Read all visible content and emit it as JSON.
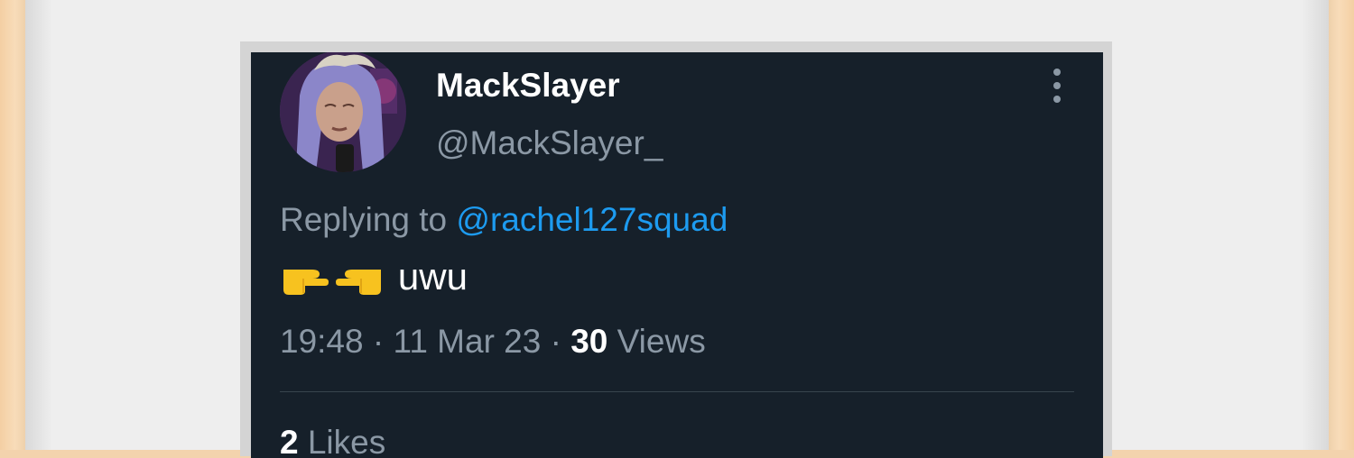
{
  "tweet": {
    "display_name": "MackSlayer",
    "handle": "@MackSlayer_",
    "more_icon": "more-vertical-icon",
    "reply_prefix": "Replying to",
    "reply_mention": "@rachel127squad",
    "emojis": [
      "point-right-emoji",
      "point-left-emoji"
    ],
    "text": "uwu",
    "time": "19:48",
    "separator": "·",
    "date": "11 Mar 23",
    "views_count": "30",
    "views_label": "Views",
    "likes_count": "2",
    "likes_label": "Likes"
  },
  "colors": {
    "background": "#16202a",
    "primary_text": "#ffffff",
    "secondary_text": "#8b98a5",
    "link": "#1d9bf0",
    "divider": "#38444d"
  }
}
